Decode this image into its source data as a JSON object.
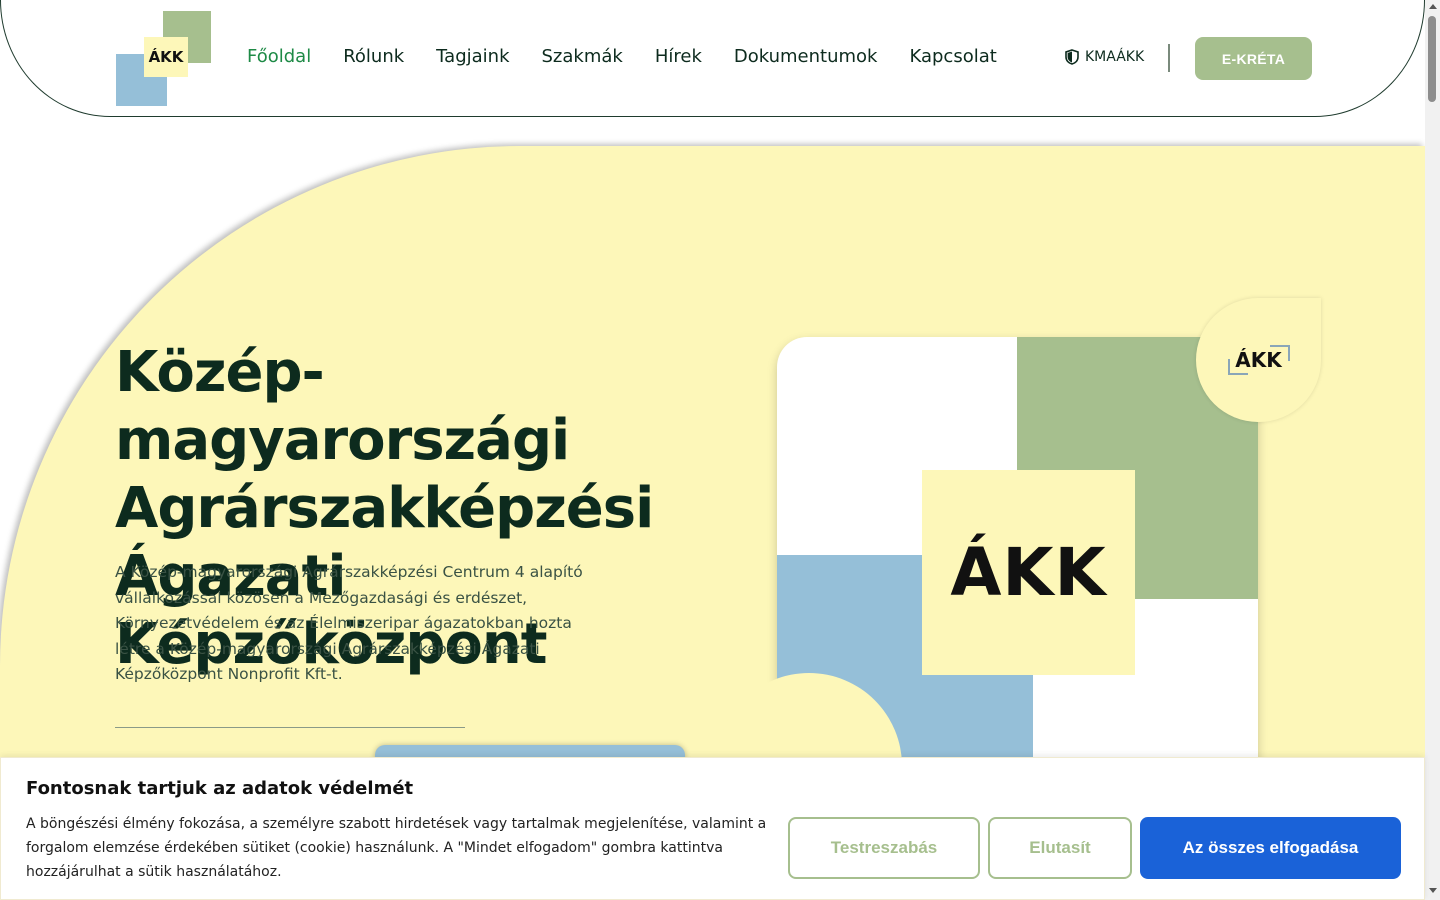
{
  "header": {
    "logo_text": "ÁKK",
    "nav": [
      {
        "label": "Főoldal",
        "active": true
      },
      {
        "label": "Rólunk"
      },
      {
        "label": "Tagjaink"
      },
      {
        "label": "Szakmák"
      },
      {
        "label": "Hírek"
      },
      {
        "label": "Dokumentumok"
      },
      {
        "label": "Kapcsolat"
      }
    ],
    "kma_label": "KMAÁKK",
    "kma_icon": "shield-icon",
    "ekreta_label": "E-KRÉTA"
  },
  "hero": {
    "title_lines": [
      "Közép-magyarországi",
      "Agrárszakképzési",
      "Ágazati Képzőközpont"
    ],
    "description": "A Közép-magyarországi Agrárszakképzési Centrum 4 alapító vállalkozással közösen a Mezőgazdasági és erdészet, Környezetvédelem és az Élelmiszeripar ágazatokban hozta létre a Közép-magyarországi Agrárszakképzési Ágazati Képzőközpont Nonprofit Kft-t.",
    "card_logo": "ÁKK",
    "badge_logo": "ÁKK"
  },
  "cookie": {
    "title": "Fontosnak tartjuk az adatok védelmét",
    "text": "A böngészési élmény fokozása, a személyre szabott hirdetések vagy tartalmak megjelenítése, valamint a forgalom elemzése érdekében sütiket (cookie) használunk. A \"Mindet elfogadom\" gombra kattintva hozzájárulhat a sütik használatához.",
    "customize_label": "Testreszabás",
    "reject_label": "Elutasít",
    "accept_label": "Az összes elfogadása"
  },
  "colors": {
    "brand_green": "#a6bf8e",
    "brand_blue": "#95bfd8",
    "brand_yellow": "#fdf7b9",
    "active_nav": "#1e8a46",
    "accept_blue": "#1a62d8"
  }
}
